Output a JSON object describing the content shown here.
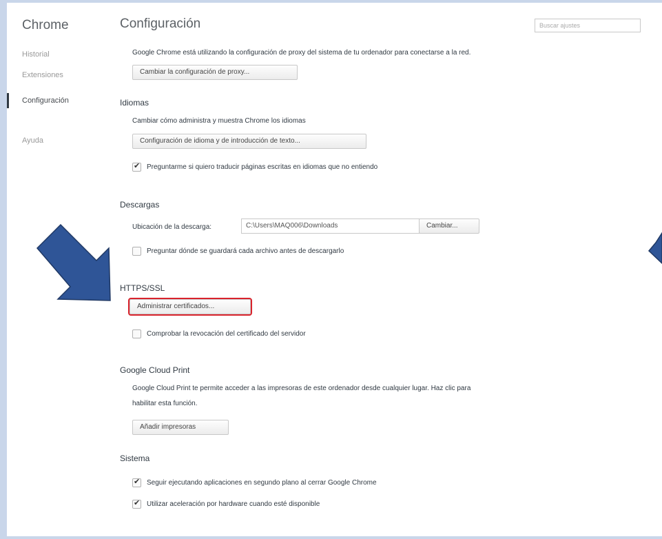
{
  "sidebar": {
    "brand": "Chrome",
    "items": [
      {
        "label": "Historial"
      },
      {
        "label": "Extensiones"
      },
      {
        "label": "Configuración"
      },
      {
        "label": "Ayuda"
      }
    ]
  },
  "header": {
    "title": "Configuración",
    "search_placeholder": "Buscar ajustes"
  },
  "proxy": {
    "description": "Google Chrome está utilizando la configuración de proxy del sistema de tu ordenador para conectarse a la red.",
    "button": "Cambiar la configuración de proxy..."
  },
  "languages": {
    "title": "Idiomas",
    "description": "Cambiar cómo administra y muestra Chrome los idiomas",
    "button": "Configuración de idioma y de introducción de texto...",
    "translate_checkbox": {
      "label": "Preguntarme si quiero traducir páginas escritas en idiomas que no entiendo",
      "checked": true
    }
  },
  "downloads": {
    "title": "Descargas",
    "location_label": "Ubicación de la descarga:",
    "location_value": "C:\\Users\\MAQ006\\Downloads",
    "change_button": "Cambiar...",
    "ask_checkbox": {
      "label": "Preguntar dónde se guardará cada archivo antes de descargarlo",
      "checked": false
    }
  },
  "https": {
    "title": "HTTPS/SSL",
    "button": "Administrar certificados...",
    "revocation_checkbox": {
      "label": "Comprobar la revocación del certificado del servidor",
      "checked": false
    }
  },
  "cloud_print": {
    "title": "Google Cloud Print",
    "description_line1": "Google Cloud Print te permite acceder a las impresoras de este ordenador desde cualquier lugar. Haz clic para",
    "description_line2": "habilitar esta función.",
    "button": "Añadir impresoras"
  },
  "system": {
    "title": "Sistema",
    "background_checkbox": {
      "label": "Seguir ejecutando aplicaciones en segundo plano al cerrar Google Chrome",
      "checked": true
    },
    "hardware_checkbox": {
      "label": "Utilizar aceleración por hardware cuando esté disponible",
      "checked": true
    }
  },
  "colors": {
    "arrow": "#2f5597",
    "highlight": "#d9232c",
    "background": "#c9d6ea"
  }
}
